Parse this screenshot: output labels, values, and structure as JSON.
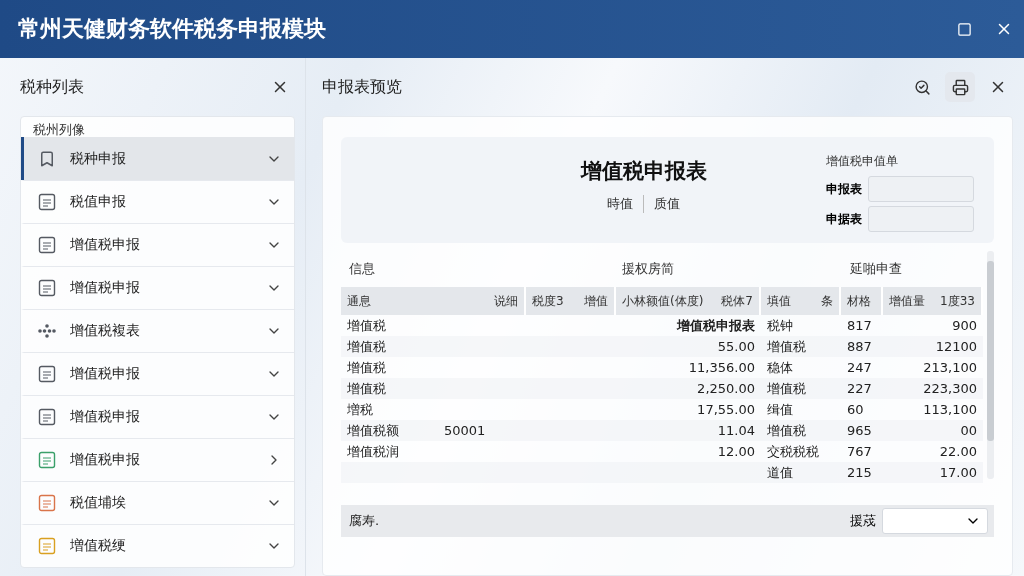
{
  "window": {
    "title": "常州天健财务软件税务申报模块"
  },
  "sidebar": {
    "title": "税种列表",
    "group_label": "税州列像",
    "items": [
      {
        "label": "税种申报",
        "selected": true,
        "expanded": true,
        "kind": "bookmark",
        "color": "#555a62"
      },
      {
        "label": "税值申报",
        "selected": false,
        "expanded": true,
        "kind": "sheet",
        "color": "#555a62"
      },
      {
        "label": "增值税申报",
        "selected": false,
        "expanded": true,
        "kind": "sheet",
        "color": "#555a62"
      },
      {
        "label": "增值税申报",
        "selected": false,
        "expanded": true,
        "kind": "sheet",
        "color": "#555a62"
      },
      {
        "label": "增值税複表",
        "selected": false,
        "expanded": true,
        "kind": "dots",
        "color": "#555a62"
      },
      {
        "label": "增值税申报",
        "selected": false,
        "expanded": true,
        "kind": "sheet",
        "color": "#555a62"
      },
      {
        "label": "增值税申报",
        "selected": false,
        "expanded": true,
        "kind": "sheet",
        "color": "#555a62"
      },
      {
        "label": "增值税申报",
        "selected": false,
        "expanded": false,
        "kind": "sheet",
        "color": "#3aa06a"
      },
      {
        "label": "税值埔埃",
        "selected": false,
        "expanded": true,
        "kind": "sheet",
        "color": "#d9744a"
      },
      {
        "label": "増值税绠",
        "selected": false,
        "expanded": true,
        "kind": "sheet",
        "color": "#d9a020"
      }
    ]
  },
  "preview": {
    "title": "申报表预览",
    "form": {
      "title": "增值税申报表",
      "subtitle": [
        "時值",
        "质值"
      ],
      "side_title": "增值税申值单",
      "fields": [
        {
          "label": "申报表"
        },
        {
          "label": "申据表"
        }
      ]
    },
    "sections": [
      "信息",
      "援权房简",
      "延啪申查"
    ],
    "header": [
      [
        "通息",
        "说细"
      ],
      [
        "税度3",
        "增值"
      ],
      [
        "小林额值(体度)",
        "税体7"
      ],
      [
        "填值",
        "条"
      ],
      [
        "材格"
      ],
      [
        "增值量",
        "1度33"
      ]
    ],
    "rows": [
      {
        "name": "增值税",
        "code": "",
        "amount": "增值税申报表",
        "kind": "title",
        "label": "税钟",
        "count": "817",
        "value": "900"
      },
      {
        "name": "增值税",
        "code": "",
        "amount": "55.00",
        "kind": "number",
        "label": "增值税",
        "count": "887",
        "value": "12100"
      },
      {
        "name": "增值税",
        "code": "",
        "amount": "11,356.00",
        "kind": "number",
        "label": "稳体",
        "count": "247",
        "value": "213,100"
      },
      {
        "name": "增值税",
        "code": "",
        "amount": "2,250.00",
        "kind": "number",
        "label": "增值税",
        "count": "227",
        "value": "223,300"
      },
      {
        "name": "増税",
        "code": "",
        "amount": "17,55.00",
        "kind": "number",
        "label": "缉值",
        "count": "60",
        "value": "113,100"
      },
      {
        "name": "增值税额",
        "code": "50001",
        "amount": "11.04",
        "kind": "number",
        "label": "增值税",
        "count": "965",
        "value": "00"
      },
      {
        "name": "增值税润",
        "code": "",
        "amount": "12.00",
        "kind": "number",
        "label": "交税税税",
        "count": "767",
        "value": "22.00"
      },
      {
        "name": "",
        "code": "",
        "amount": "",
        "kind": "number",
        "label": "道值",
        "count": "215",
        "value": "17.00"
      }
    ],
    "footer": {
      "label": "腐寿.",
      "select_label": "援荗"
    }
  }
}
